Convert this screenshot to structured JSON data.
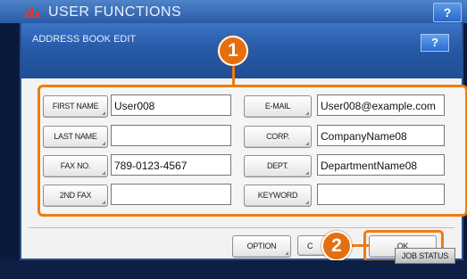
{
  "outer": {
    "title": "USER FUNCTIONS",
    "help": "?"
  },
  "dialog": {
    "title": "ADDRESS BOOK EDIT",
    "help": "?"
  },
  "callouts": {
    "one": "1",
    "two": "2"
  },
  "left_fields": [
    {
      "label": "FIRST NAME",
      "value": "User008"
    },
    {
      "label": "LAST NAME",
      "value": ""
    },
    {
      "label": "FAX NO.",
      "value": "789-0123-4567"
    },
    {
      "label": "2ND FAX",
      "value": ""
    }
  ],
  "right_fields": [
    {
      "label": "E-MAIL",
      "value": "User008@example.com"
    },
    {
      "label": "CORP.",
      "value": "CompanyName08"
    },
    {
      "label": "DEPT.",
      "value": "DepartmentName08"
    },
    {
      "label": "KEYWORD",
      "value": ""
    }
  ],
  "footer": {
    "option": "OPTION",
    "cancel": "C",
    "ok": "OK"
  },
  "status": {
    "job_status": "JOB STATUS"
  },
  "colors": {
    "callout": "#e56f0f",
    "title_bar": "#285aa7"
  }
}
